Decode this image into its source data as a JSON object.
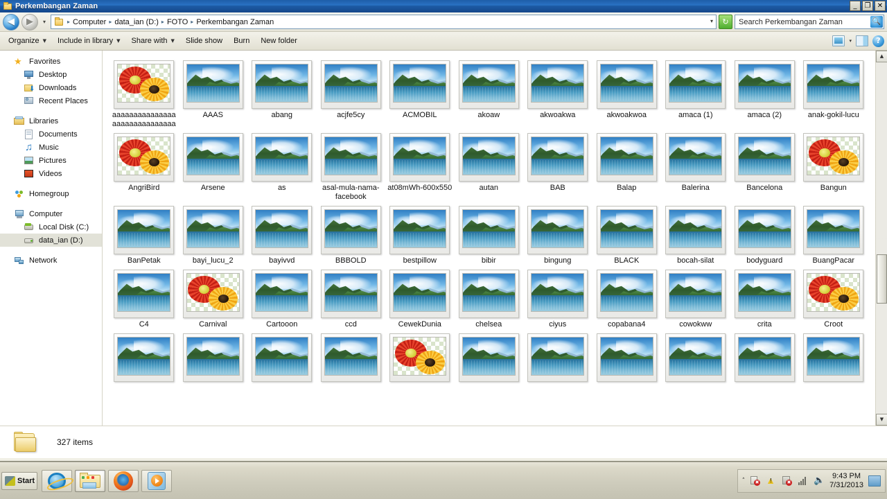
{
  "window": {
    "title": "Perkembangan Zaman",
    "titlebar_icon": "folder-icon",
    "minimize_label": "_",
    "restore_label": "❐",
    "close_label": "✕"
  },
  "address_bar": {
    "back_label": "◀",
    "forward_label": "▶",
    "history_label": "▾",
    "folder_icon": "folder-icon",
    "crumbs": [
      "Computer",
      "data_ian (D:)",
      "FOTO",
      "Perkembangan Zaman"
    ],
    "separator": "▸",
    "dropdown_label": "▾",
    "refresh_label": "↻"
  },
  "search": {
    "placeholder": "Search Perkembangan Zaman",
    "icon": "search-icon"
  },
  "command_bar": {
    "items": [
      {
        "label": "Organize",
        "has_caret": true
      },
      {
        "label": "Include in library",
        "has_caret": true
      },
      {
        "label": "Share with",
        "has_caret": true
      },
      {
        "label": "Slide show",
        "has_caret": false
      },
      {
        "label": "Burn",
        "has_caret": false
      },
      {
        "label": "New folder",
        "has_caret": false
      }
    ],
    "view_button": "change-view-icon",
    "view_caret": "▾",
    "preview_pane_button": "preview-pane-icon",
    "help_label": "?"
  },
  "nav_pane": {
    "groups": [
      {
        "header": {
          "label": "Favorites",
          "icon": "favorites-star-icon"
        },
        "items": [
          {
            "label": "Desktop",
            "icon": "desktop-icon"
          },
          {
            "label": "Downloads",
            "icon": "downloads-icon"
          },
          {
            "label": "Recent Places",
            "icon": "recent-places-icon"
          }
        ]
      },
      {
        "header": {
          "label": "Libraries",
          "icon": "libraries-icon"
        },
        "items": [
          {
            "label": "Documents",
            "icon": "documents-icon"
          },
          {
            "label": "Music",
            "icon": "music-icon"
          },
          {
            "label": "Pictures",
            "icon": "pictures-icon"
          },
          {
            "label": "Videos",
            "icon": "videos-icon"
          }
        ]
      },
      {
        "header": {
          "label": "Homegroup",
          "icon": "homegroup-icon"
        },
        "items": []
      },
      {
        "header": {
          "label": "Computer",
          "icon": "computer-icon"
        },
        "items": [
          {
            "label": "Local Disk (C:)",
            "icon": "harddisk-icon",
            "selected": false
          },
          {
            "label": "data_ian (D:)",
            "icon": "drive-icon",
            "selected": true
          }
        ]
      },
      {
        "header": {
          "label": "Network",
          "icon": "network-icon"
        },
        "items": []
      }
    ]
  },
  "files": [
    {
      "name": "aaaaaaaaaaaaaaaaaaaaaaaaaaaaaa",
      "thumb": "flowers"
    },
    {
      "name": "AAAS",
      "thumb": "landscape"
    },
    {
      "name": "abang",
      "thumb": "landscape"
    },
    {
      "name": "acjfe5cy",
      "thumb": "landscape"
    },
    {
      "name": "ACMOBIL",
      "thumb": "landscape"
    },
    {
      "name": "akoaw",
      "thumb": "landscape"
    },
    {
      "name": "akwoakwa",
      "thumb": "landscape"
    },
    {
      "name": "akwoakwoa",
      "thumb": "landscape"
    },
    {
      "name": "amaca (1)",
      "thumb": "landscape"
    },
    {
      "name": "amaca (2)",
      "thumb": "landscape"
    },
    {
      "name": "anak-gokil-lucu",
      "thumb": "landscape"
    },
    {
      "name": "AngriBird",
      "thumb": "flowers"
    },
    {
      "name": "Arsene",
      "thumb": "landscape"
    },
    {
      "name": "as",
      "thumb": "landscape"
    },
    {
      "name": "asal-mula-nama-facebook",
      "thumb": "landscape"
    },
    {
      "name": "at08mWh-600x550",
      "thumb": "landscape"
    },
    {
      "name": "autan",
      "thumb": "landscape"
    },
    {
      "name": "BAB",
      "thumb": "landscape"
    },
    {
      "name": "Balap",
      "thumb": "landscape"
    },
    {
      "name": "Balerina",
      "thumb": "landscape"
    },
    {
      "name": "Bancelona",
      "thumb": "landscape"
    },
    {
      "name": "Bangun",
      "thumb": "flowers"
    },
    {
      "name": "BanPetak",
      "thumb": "landscape"
    },
    {
      "name": "bayi_lucu_2",
      "thumb": "landscape"
    },
    {
      "name": "bayivvd",
      "thumb": "landscape"
    },
    {
      "name": "BBBOLD",
      "thumb": "landscape"
    },
    {
      "name": "bestpillow",
      "thumb": "landscape"
    },
    {
      "name": "bibir",
      "thumb": "landscape"
    },
    {
      "name": "bingung",
      "thumb": "landscape"
    },
    {
      "name": "BLACK",
      "thumb": "landscape"
    },
    {
      "name": "bocah-silat",
      "thumb": "landscape"
    },
    {
      "name": "bodyguard",
      "thumb": "landscape"
    },
    {
      "name": "BuangPacar",
      "thumb": "landscape"
    },
    {
      "name": "C4",
      "thumb": "landscape"
    },
    {
      "name": "Carnival",
      "thumb": "flowers"
    },
    {
      "name": "Cartooon",
      "thumb": "landscape"
    },
    {
      "name": "ccd",
      "thumb": "landscape"
    },
    {
      "name": "CewekDunia",
      "thumb": "landscape"
    },
    {
      "name": "chelsea",
      "thumb": "landscape"
    },
    {
      "name": "ciyus",
      "thumb": "landscape"
    },
    {
      "name": "copabana4",
      "thumb": "landscape"
    },
    {
      "name": "cowokww",
      "thumb": "landscape"
    },
    {
      "name": "crita",
      "thumb": "landscape"
    },
    {
      "name": "Croot",
      "thumb": "flowers"
    },
    {
      "name": "",
      "thumb": "landscape"
    },
    {
      "name": "",
      "thumb": "landscape"
    },
    {
      "name": "",
      "thumb": "landscape"
    },
    {
      "name": "",
      "thumb": "landscape"
    },
    {
      "name": "",
      "thumb": "flowers"
    },
    {
      "name": "",
      "thumb": "landscape"
    },
    {
      "name": "",
      "thumb": "landscape"
    },
    {
      "name": "",
      "thumb": "landscape"
    },
    {
      "name": "",
      "thumb": "landscape"
    },
    {
      "name": "",
      "thumb": "landscape"
    },
    {
      "name": "",
      "thumb": "landscape"
    }
  ],
  "scrollbar": {
    "up_label": "▲",
    "down_label": "▼"
  },
  "details_pane": {
    "folder_icon": "folder-icon",
    "item_count": "327 items"
  },
  "taskbar": {
    "start_label": "Start",
    "buttons": [
      {
        "name": "internet-explorer",
        "active": false
      },
      {
        "name": "windows-explorer",
        "active": true
      },
      {
        "name": "firefox",
        "active": false
      },
      {
        "name": "windows-media-player",
        "active": false
      }
    ],
    "tray": {
      "chevron": "˄",
      "icons": [
        "action-center-flag-icon",
        "warning-triangle-icon",
        "antivirus-icon",
        "network-signal-icon",
        "volume-icon"
      ],
      "time": "9:43 PM",
      "date": "7/31/2013",
      "show_desktop": "show-desktop-button"
    }
  },
  "colors": {
    "titlebar_blue": "#1d5ca6",
    "selection": "#e2e2d8",
    "chrome": "#f0efe5",
    "taskbar": "#cfcdbd"
  }
}
